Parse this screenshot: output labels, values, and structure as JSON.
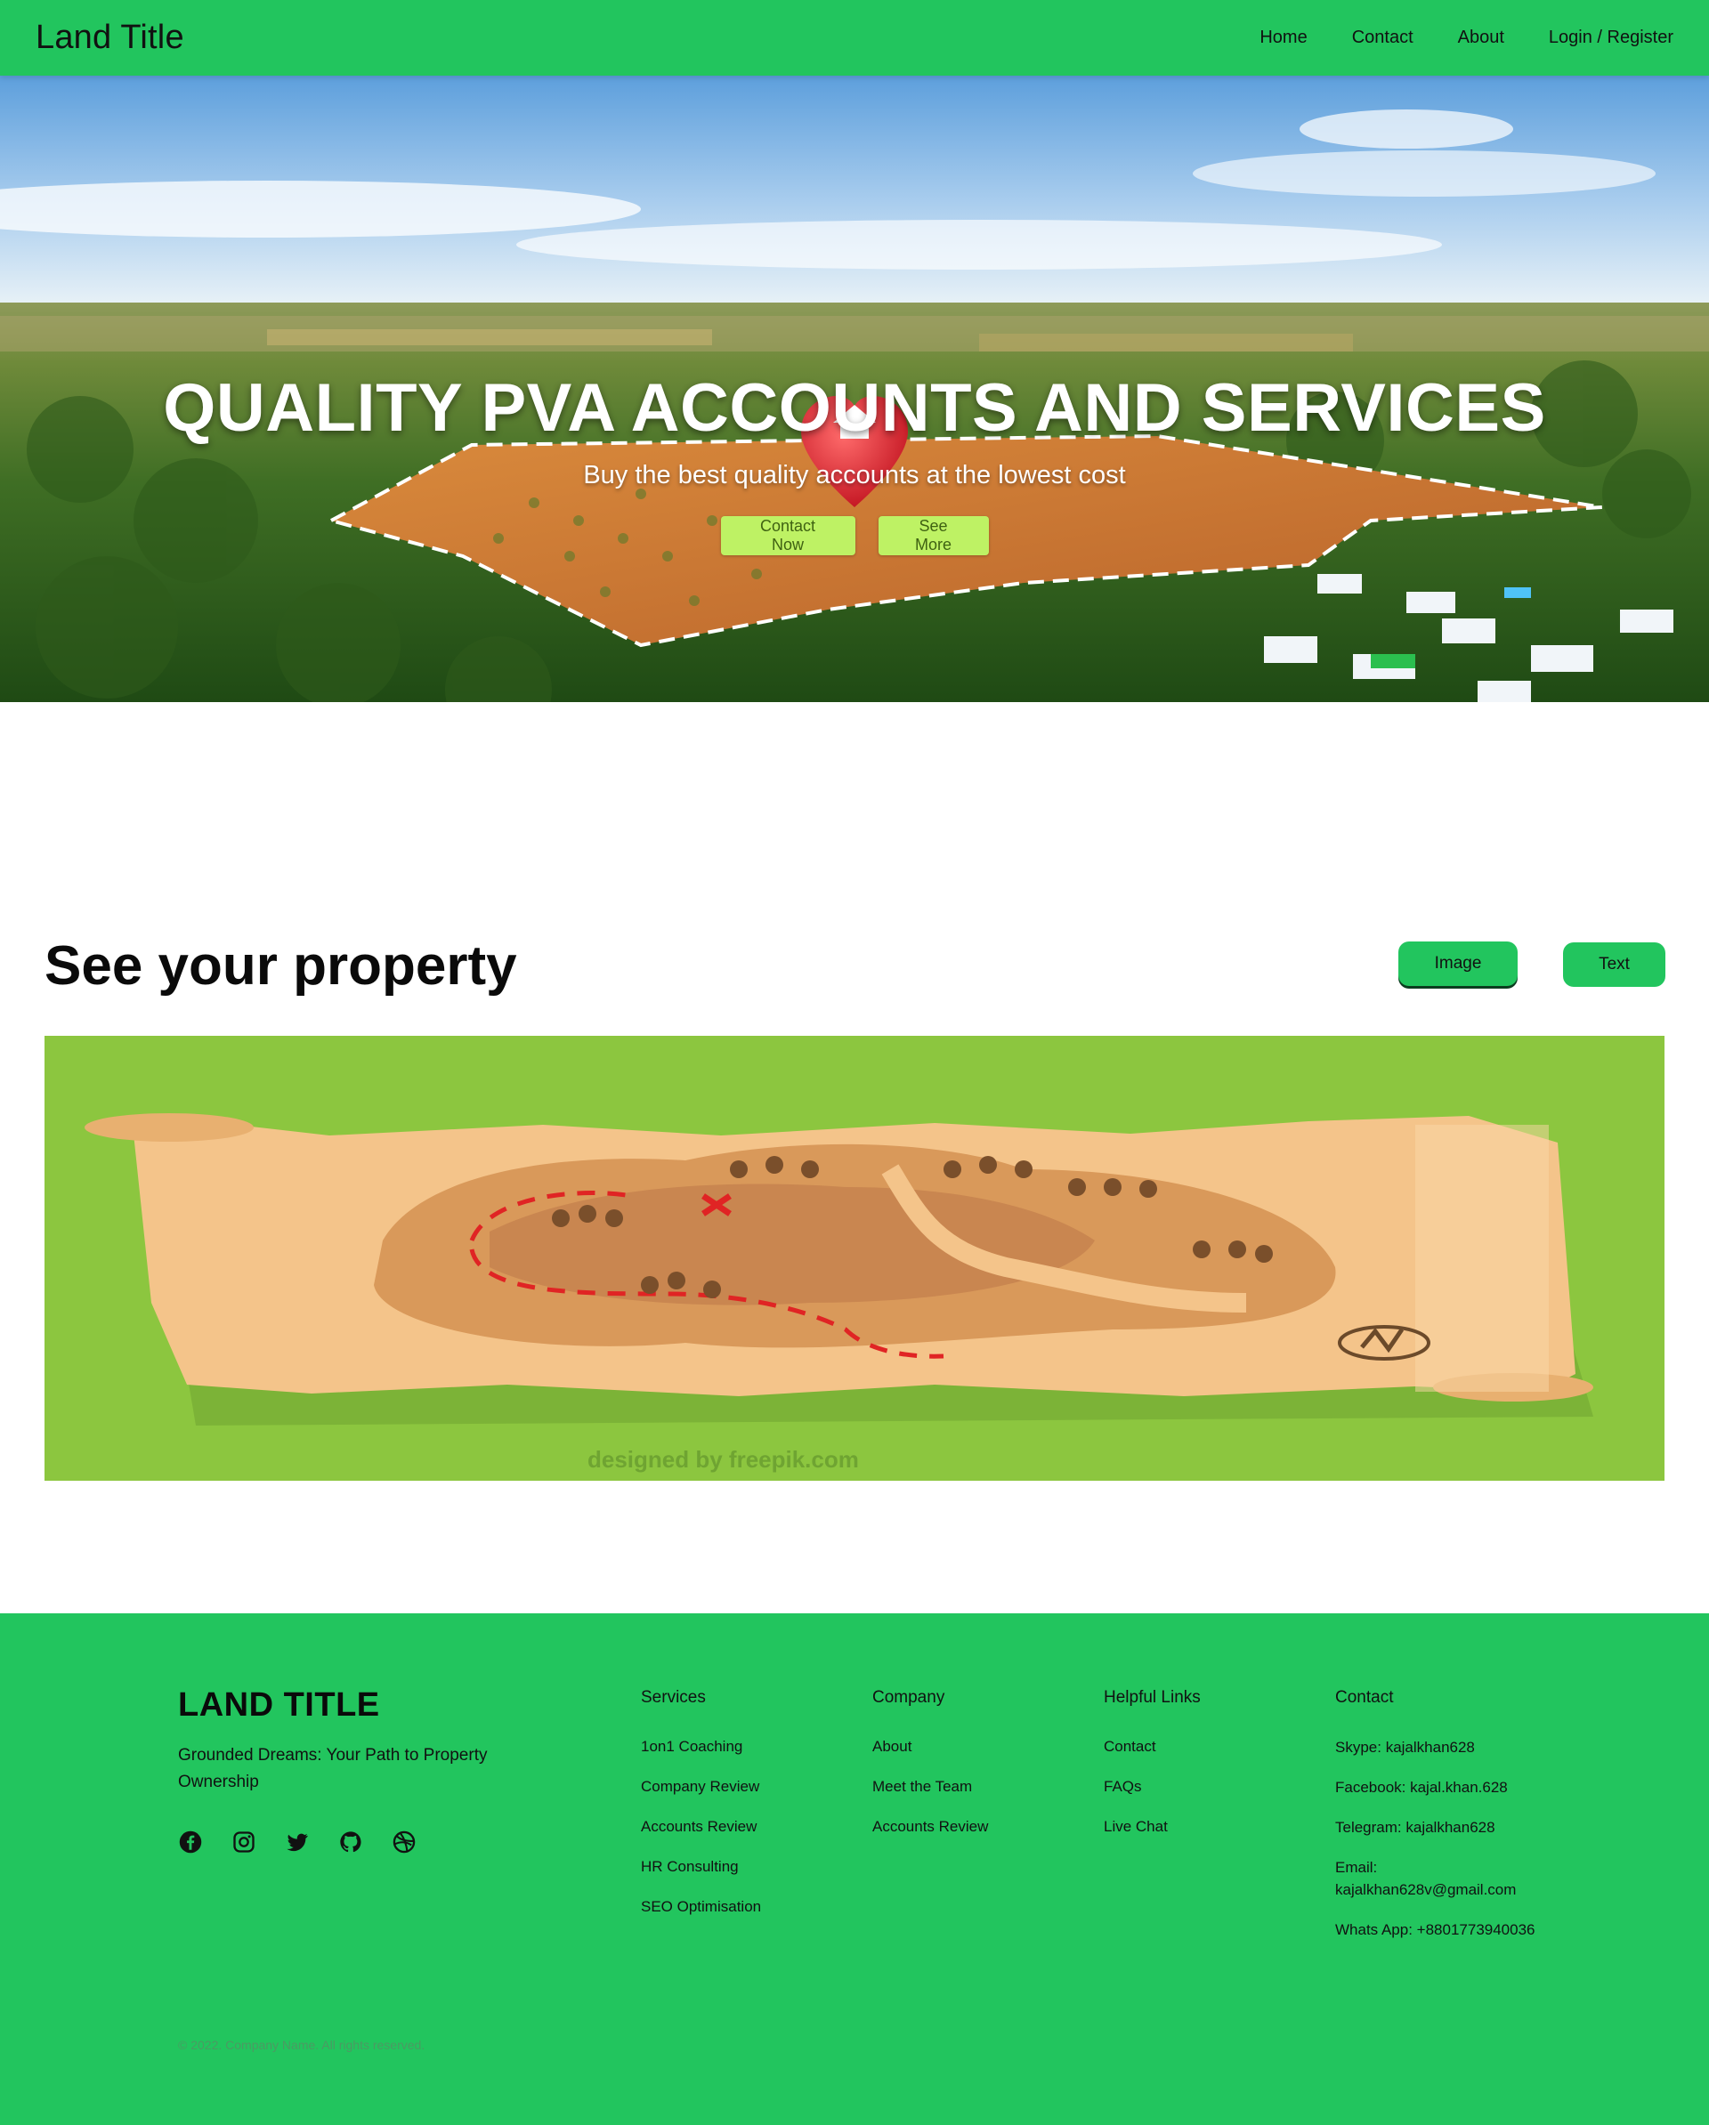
{
  "nav": {
    "brand": "Land Title",
    "links": [
      "Home",
      "Contact",
      "About",
      "Login / Register"
    ]
  },
  "hero": {
    "title": "QUALITY PVA ACCOUNTS AND SERVICES",
    "subtitle": "Buy the best quality accounts at the lowest cost",
    "contact_btn": "Contact Now",
    "see_more_btn": "See More"
  },
  "property": {
    "title": "See your property",
    "image_btn": "Image",
    "text_btn": "Text",
    "watermark": "designed by freepik.com"
  },
  "footer": {
    "brand": "LAND TITLE",
    "tagline": "Grounded Dreams: Your Path to Property Ownership",
    "social_icons": [
      "facebook-icon",
      "instagram-icon",
      "twitter-icon",
      "github-icon",
      "dribbble-icon"
    ],
    "services": {
      "heading": "Services",
      "items": [
        "1on1 Coaching",
        "Company Review",
        "Accounts Review",
        "HR Consulting",
        "SEO Optimisation"
      ]
    },
    "company": {
      "heading": "Company",
      "items": [
        "About",
        "Meet the Team",
        "Accounts Review"
      ]
    },
    "helpful": {
      "heading": "Helpful Links",
      "items": [
        "Contact",
        "FAQs",
        "Live Chat"
      ]
    },
    "contact": {
      "heading": "Contact",
      "items": [
        "Skype: kajalkhan628",
        "Facebook: kajal.khan.628",
        "Telegram: kajalkhan628",
        "Email: kajalkhan628v@gmail.com",
        "Whats App: +8801773940036"
      ]
    },
    "copyright": "© 2022. Company Name. All rights reserved."
  },
  "colors": {
    "brand_green": "#22c55e",
    "hero_button": "#bef264",
    "map_background": "#8cc63f"
  }
}
